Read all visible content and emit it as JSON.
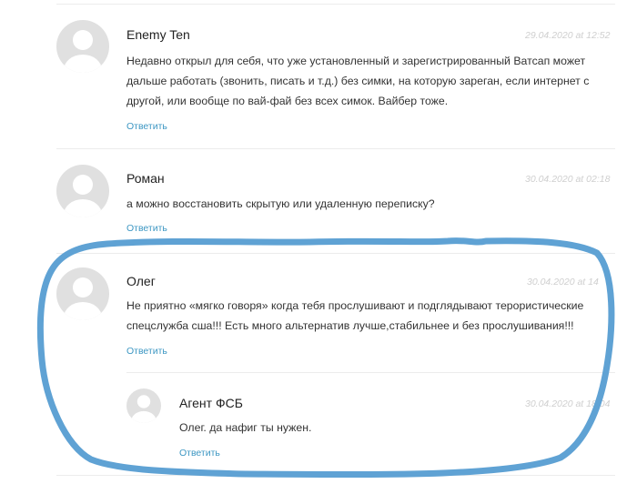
{
  "accent_color": "#3d97c3",
  "highlight_color": "#5fa2d4",
  "comments": [
    {
      "author": "Enemy Ten",
      "date": "29.04.2020 at 12:52",
      "lines": [
        "Недавно открыл для себя, что уже установленный и зарегистрированный Ватсап может",
        "дальше работать (звонить, писать и т.д.) без симки, на которую зареган, если интернет с",
        "другой, или вообще по вай-фай без всех симок. Вайбер тоже."
      ],
      "reply": "Ответить"
    },
    {
      "author": "Роман",
      "date": "30.04.2020 at 02:18",
      "lines": [
        "а можно восстановить скрытую или удаленную переписку?"
      ],
      "reply": "Ответить"
    },
    {
      "author": "Олег",
      "date": "30.04.2020 at 14",
      "lines": [
        "Не приятно «мягко говоря» когда тебя прослушивают и подглядывают терористические",
        "спецслужба сша!!! Есть много альтернатив лучше,стабильнее и без прослушивания!!!"
      ],
      "reply": "Ответить"
    },
    {
      "author": "Агент ФСБ",
      "date": "30.04.2020 at 18:04",
      "lines": [
        "Олег. да нафиг ты нужен."
      ],
      "reply": "Ответить"
    }
  ]
}
